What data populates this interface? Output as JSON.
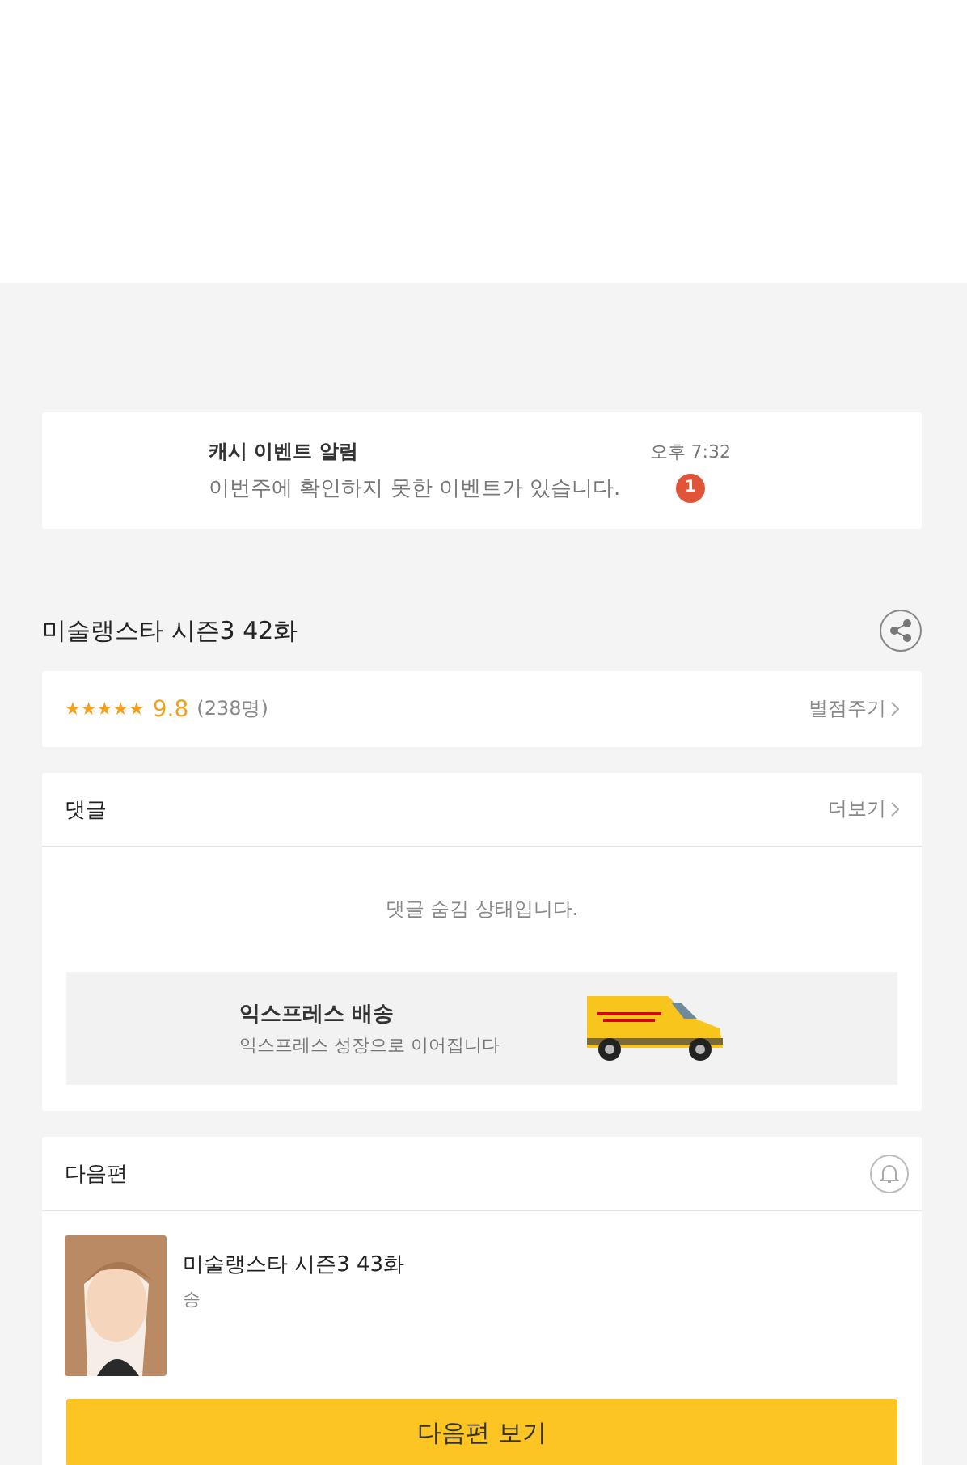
{
  "notification": {
    "title": "캐시 이벤트 알림",
    "message": "이번주에 확인하지 못한 이벤트가 있습니다.",
    "time": "오후 7:32",
    "badge": "1"
  },
  "episode": {
    "title": "미술랭스타 시즌3 42화"
  },
  "rating": {
    "stars": 5,
    "score": "9.8",
    "count": "(238명)",
    "action": "별점주기"
  },
  "comments": {
    "title": "댓글",
    "more": "더보기",
    "status": "댓글 숨김 상태입니다."
  },
  "ad": {
    "title": "익스프레스 배송",
    "subtitle": "익스프레스 성장으로 이어집니다"
  },
  "next": {
    "title": "다음편",
    "episode_title": "미술랭스타 시즌3 43화",
    "author": "송",
    "button": "다음편 보기"
  }
}
